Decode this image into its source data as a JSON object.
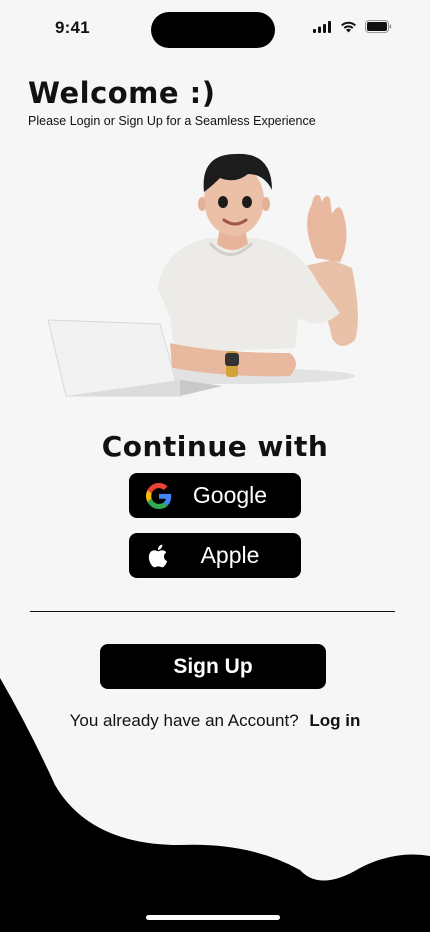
{
  "status_bar": {
    "time": "9:41"
  },
  "welcome": {
    "title": "Welcome :)",
    "subtitle": "Please Login or Sign Up for a Seamless Experience"
  },
  "auth": {
    "heading": "Continue with",
    "google_label": "Google",
    "apple_label": "Apple",
    "google_icon": "google-logo-icon",
    "apple_icon": "apple-logo-icon"
  },
  "signup": {
    "label": "Sign Up"
  },
  "account": {
    "prompt": "You already have an Account?",
    "login_label": "Log in"
  },
  "colors": {
    "background": "#f6f6f6",
    "button": "#000000",
    "button_text": "#ffffff",
    "wave": "#000000"
  }
}
